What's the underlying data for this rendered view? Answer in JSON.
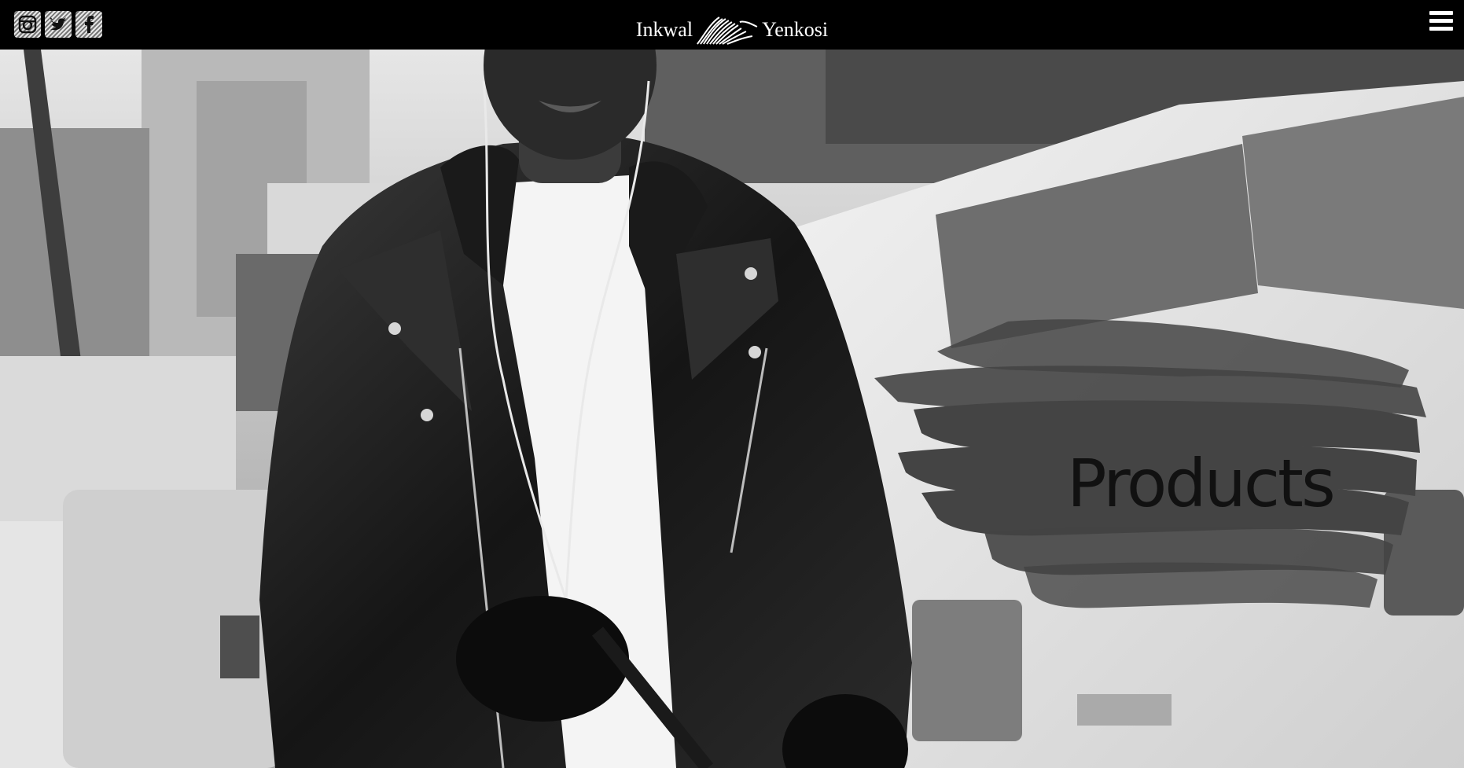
{
  "header": {
    "brand_left": "Inkwal",
    "brand_right": "Yenkosi",
    "brand_logo_icon": "scribble-logo-icon",
    "social_icons": [
      "instagram-icon",
      "twitter-icon",
      "facebook-icon"
    ],
    "menu_icon": "hamburger-menu-icon",
    "background": "#000000",
    "text_color": "#ffffff"
  },
  "hero": {
    "image": "black-and-white photo of man in leather jacket walking on city street",
    "cta_label": "Products",
    "brush_color": "#444444"
  }
}
